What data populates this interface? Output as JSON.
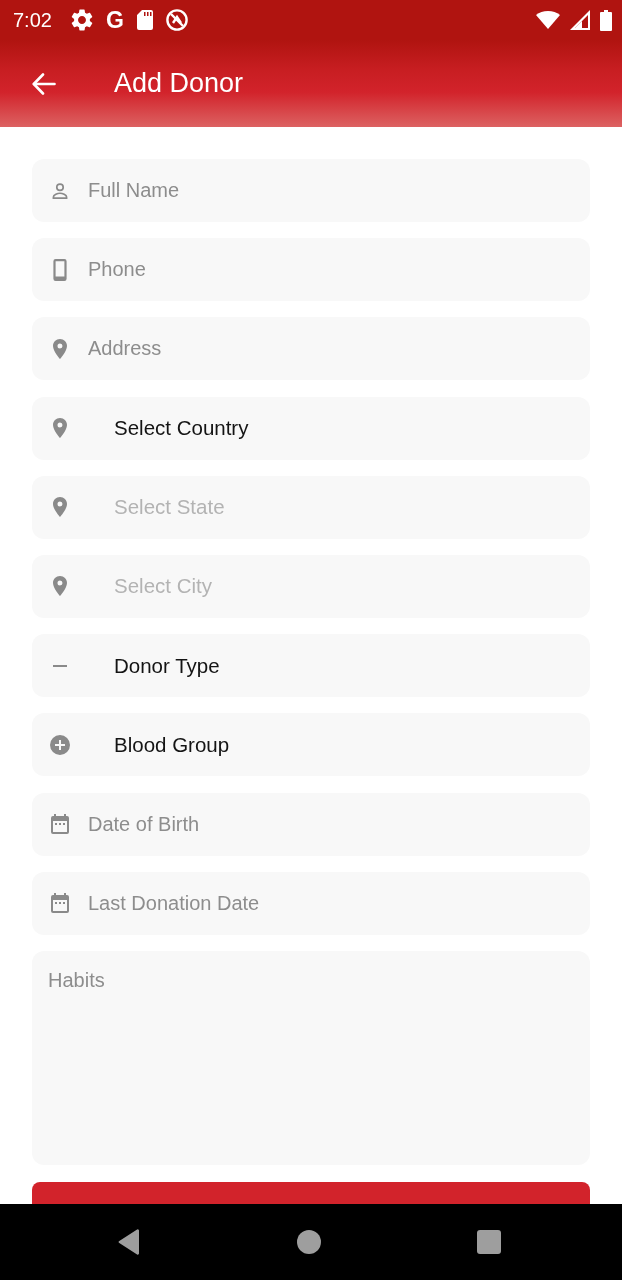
{
  "status_bar": {
    "time": "7:02",
    "notification_letter": "G"
  },
  "app_bar": {
    "title": "Add Donor"
  },
  "fields": [
    {
      "kind": "name",
      "placeholder": "Full Name",
      "disabled": false
    },
    {
      "kind": "phone",
      "placeholder": "Phone",
      "disabled": false
    },
    {
      "kind": "address",
      "placeholder": "Address",
      "disabled": false
    },
    {
      "kind": "location",
      "value": "Select Country",
      "disabled": false
    },
    {
      "kind": "location",
      "value": "Select State",
      "disabled": true
    },
    {
      "kind": "location",
      "value": "Select City",
      "disabled": true
    },
    {
      "kind": "type",
      "value": "Donor Type",
      "disabled": false
    },
    {
      "kind": "group",
      "value": "Blood Group",
      "disabled": false
    },
    {
      "kind": "date",
      "placeholder": "Date of Birth",
      "disabled": false
    },
    {
      "kind": "date",
      "placeholder": "Last Donation Date",
      "disabled": false
    }
  ],
  "habits": {
    "placeholder": "Habits"
  }
}
